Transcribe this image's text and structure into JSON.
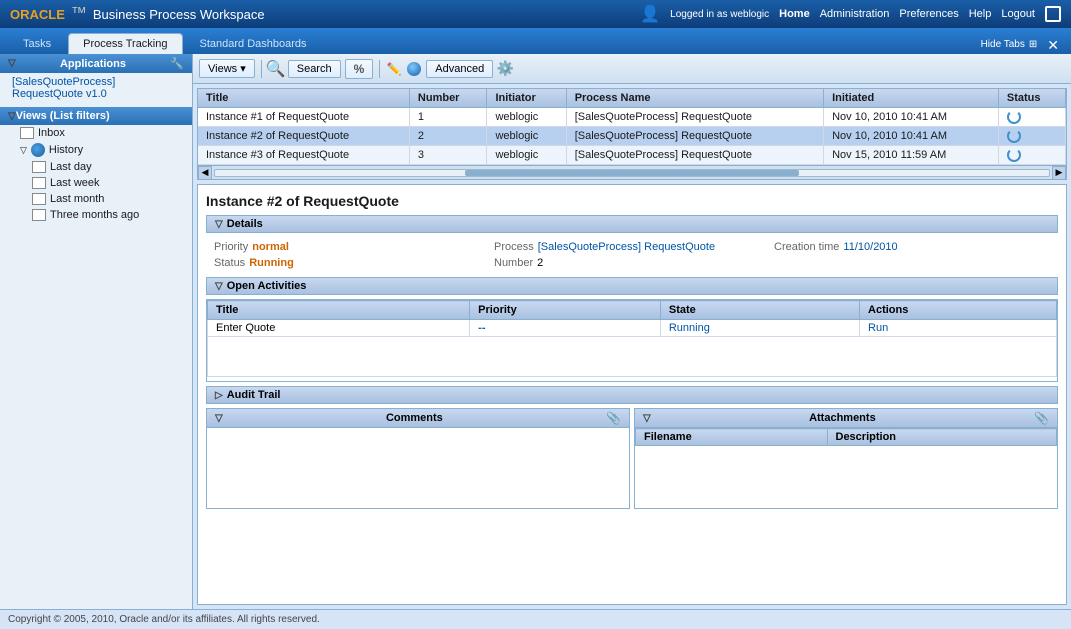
{
  "header": {
    "oracle_logo": "ORACLE",
    "app_title": "Business Process Workspace",
    "logged_in_text": "Logged in as weblogic",
    "nav_items": [
      "Home",
      "Administration",
      "Preferences",
      "Help",
      "Logout"
    ]
  },
  "tabs": [
    {
      "label": "Tasks",
      "active": false
    },
    {
      "label": "Process Tracking",
      "active": true
    },
    {
      "label": "Standard Dashboards",
      "active": false
    }
  ],
  "hide_tabs_label": "Hide Tabs",
  "sidebar": {
    "applications_label": "Applications",
    "app_link": "[SalesQuoteProcess] RequestQuote v1.0",
    "views_label": "Views (List filters)",
    "inbox_label": "Inbox",
    "history_label": "History",
    "history_children": [
      "Last day",
      "Last week",
      "Last month",
      "Three months ago"
    ]
  },
  "toolbar": {
    "views_label": "Views ▾",
    "search_label": "Search",
    "percent_label": "%",
    "advanced_label": "Advanced"
  },
  "table": {
    "columns": [
      "Title",
      "Number",
      "Initiator",
      "Process Name",
      "Initiated",
      "Status"
    ],
    "rows": [
      {
        "title": "Instance #1 of RequestQuote",
        "number": "1",
        "initiator": "weblogic",
        "process_name": "[SalesQuoteProcess] RequestQuote",
        "initiated": "Nov 10, 2010 10:41 AM",
        "status": "icon"
      },
      {
        "title": "Instance #2 of RequestQuote",
        "number": "2",
        "initiator": "weblogic",
        "process_name": "[SalesQuoteProcess] RequestQuote",
        "initiated": "Nov 10, 2010 10:41 AM",
        "status": "icon"
      },
      {
        "title": "Instance #3 of RequestQuote",
        "number": "3",
        "initiator": "weblogic",
        "process_name": "[SalesQuoteProcess] RequestQuote",
        "initiated": "Nov 15, 2010 11:59 AM",
        "status": "icon"
      }
    ]
  },
  "detail": {
    "title": "Instance #2 of RequestQuote",
    "details_label": "Details",
    "priority_label": "Priority",
    "priority_value": "normal",
    "status_label": "Status",
    "status_value": "Running",
    "process_label": "Process",
    "process_value": "[SalesQuoteProcess] RequestQuote",
    "number_label": "Number",
    "number_value": "2",
    "creation_time_label": "Creation time",
    "creation_time_value": "11/10/2010",
    "open_activities_label": "Open Activities",
    "activity_columns": [
      "Title",
      "Priority",
      "State",
      "Actions"
    ],
    "activities": [
      {
        "title": "Enter Quote",
        "priority": "--",
        "state": "Running",
        "action": "Run"
      }
    ],
    "audit_trail_label": "Audit Trail",
    "comments_label": "Comments",
    "attachments_label": "Attachments",
    "attachments_columns": [
      "Filename",
      "Description"
    ]
  },
  "footer": {
    "text": "Copyright © 2005, 2010, Oracle and/or its affiliates. All rights reserved."
  }
}
